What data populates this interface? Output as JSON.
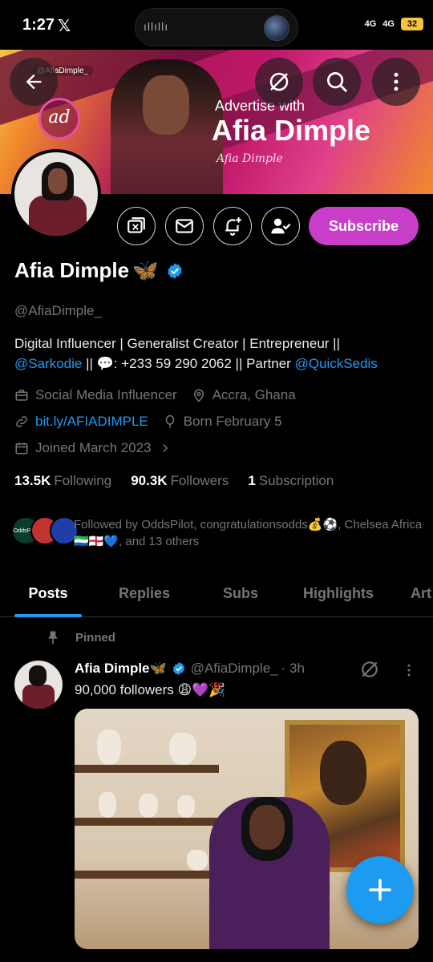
{
  "status_bar": {
    "time": "1:27",
    "app_glyph": "𝕏",
    "wave": "ıllıllı",
    "signal1": "4G",
    "signal2": "4G",
    "battery": "32"
  },
  "banner": {
    "handle": "@AfiaDimple_",
    "logo_text": "ad",
    "line1": "Advertise with",
    "line2": "Afia Dimple",
    "signature": "Afia Dimple",
    "colors": {
      "primary": "#b0175a",
      "accent": "#f6c64a"
    }
  },
  "header_icons": [
    "back-arrow-icon",
    "grok-icon",
    "search-icon",
    "more-vertical-icon"
  ],
  "actions": {
    "icons": [
      "media-icon",
      "message-icon",
      "notification-bell-icon",
      "following-user-icon"
    ],
    "subscribe_label": "Subscribe",
    "subscribe_color": "#c93ec9"
  },
  "profile": {
    "name": "Afia Dimple",
    "name_emoji": "🦋",
    "handle": "@AfiaDimple_",
    "bio_line1": "Digital Influencer | Generalist Creator | Entrepreneur ||",
    "bio_mention1": "@Sarkodie",
    "bio_mid": " || 💬: +233 59 290 2062 || Partner ",
    "bio_mention2": "@QuickSedis",
    "category": "Social Media Influencer",
    "location": "Accra, Ghana",
    "website": "bit.ly/AFIADIMPLE",
    "birthday": "Born February 5",
    "joined": "Joined March 2023"
  },
  "counts": {
    "following_value": "13.5K",
    "following_label": "Following",
    "followers_value": "90.3K",
    "followers_label": "Followers",
    "subscription_value": "1",
    "subscription_label": "Subscription"
  },
  "followed_by": {
    "text": "Followed by OddsPilot, congratulationsodds💰⚽, Chelsea Africa 🇸🇱🏴󠁧󠁢󠁥󠁮󠁧󠁿💙, and 13 others",
    "avatar1_label": "OddsPilot"
  },
  "tabs": [
    "Posts",
    "Replies",
    "Subs",
    "Highlights",
    "Art"
  ],
  "post": {
    "pinned_label": "Pinned",
    "author": "Afia Dimple",
    "author_emoji": "🦋",
    "handle": "@AfiaDimple_",
    "time": "· 3h",
    "text": "90,000 followers 😩💜🎉"
  },
  "fab_icon": "compose-plus-icon",
  "accent_color": "#1d9bf0"
}
